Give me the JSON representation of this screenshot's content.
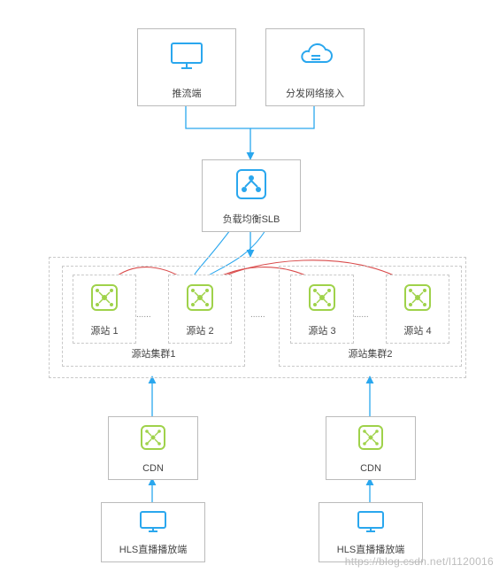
{
  "nodes": {
    "push_client": "推流端",
    "dispatch_access": "分发网络接入",
    "slb": "负载均衡SLB",
    "origin1": "源站 1",
    "origin2": "源站 2",
    "origin3": "源站 3",
    "origin4": "源站 4",
    "cluster1": "源站集群1",
    "cluster2": "源站集群2",
    "cdn_left": "CDN",
    "cdn_right": "CDN",
    "player_left": "HLS直播播放端",
    "player_right": "HLS直播播放端",
    "dots": "......"
  },
  "colors": {
    "blue": "#2aa7ee",
    "green": "#9fd24a",
    "red": "#d94b4b",
    "grey": "#bbbbbb",
    "dash": "#c9c9c9"
  },
  "watermark": "https://blog.csdn.net/l1120016"
}
